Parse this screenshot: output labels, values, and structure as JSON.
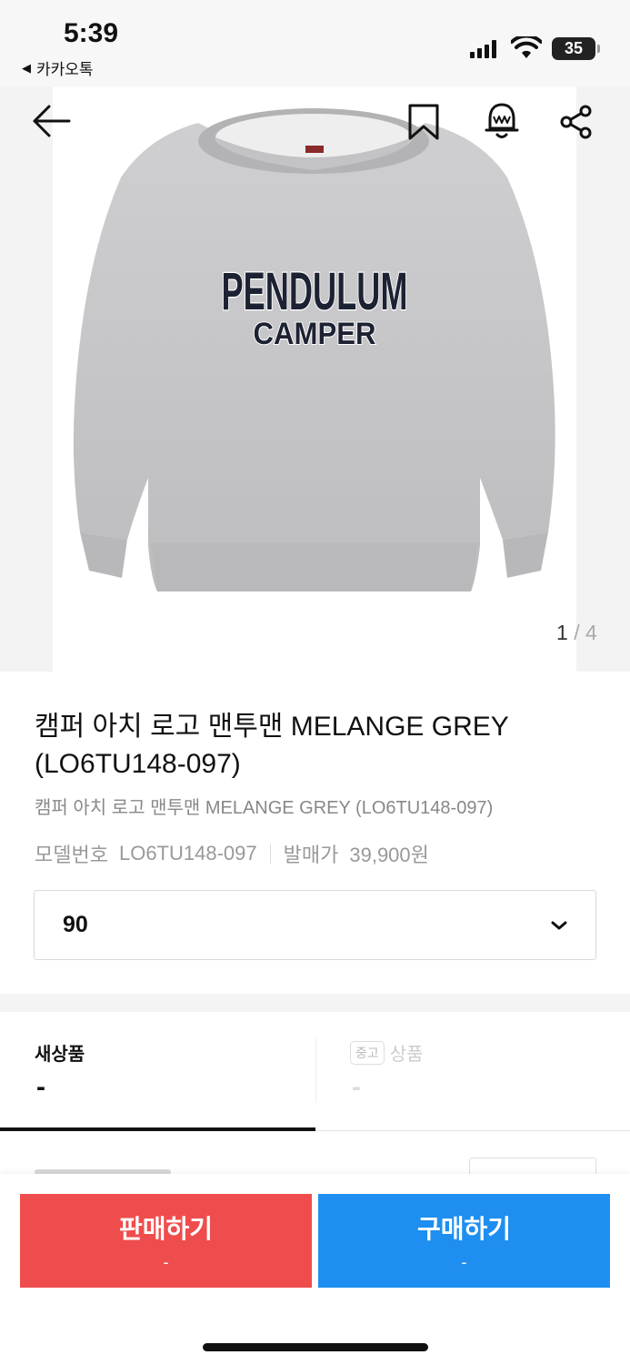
{
  "status_bar": {
    "time": "5:39",
    "back_app": "카카오톡",
    "battery": "35"
  },
  "product": {
    "image_text_line1": "PENDULUM",
    "image_text_line2": "CAMPER",
    "page_current": "1",
    "page_separator": "/",
    "page_total": "4",
    "title": "캠퍼 아치 로고 맨투맨 MELANGE GREY (LO6TU148-097)",
    "subtitle": "캠퍼 아치 로고 맨투맨 MELANGE GREY (LO6TU148-097)",
    "model_label": "모델번호",
    "model_value": "LO6TU148-097",
    "release_label": "발매가",
    "release_value": "39,900원"
  },
  "size_select": {
    "value": "90"
  },
  "condition_tabs": {
    "new_label": "새상품",
    "new_price": "-",
    "used_badge": "중고",
    "used_label": "상품",
    "used_price": "-"
  },
  "actions": {
    "sell_label": "판매하기",
    "sell_price": "-",
    "buy_label": "구매하기",
    "buy_price": "-"
  },
  "colors": {
    "sell": "#ef4d4d",
    "buy": "#1e8ff0",
    "sweatshirt": "#c7c7c9",
    "logo_text": "#1d2233"
  }
}
